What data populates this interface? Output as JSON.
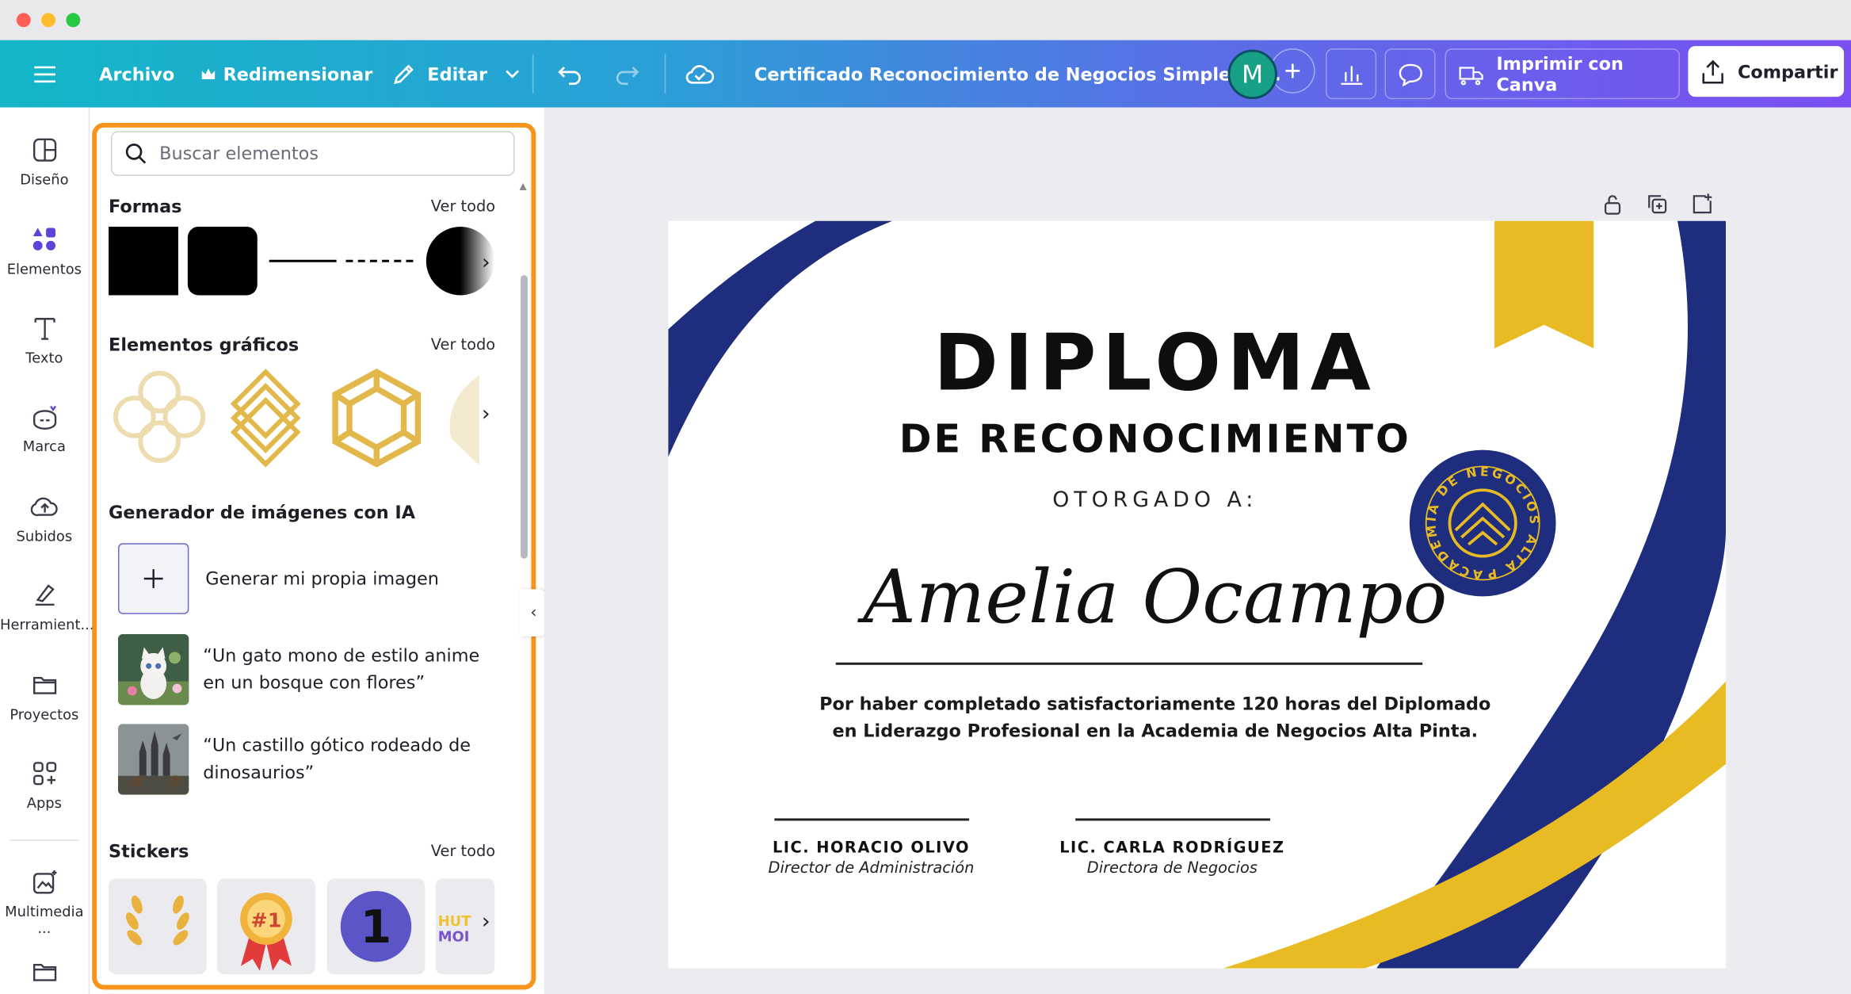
{
  "window": {
    "traffic_lights": [
      "#ff5f57",
      "#febc2e",
      "#28c840"
    ]
  },
  "toolbar": {
    "menu_label": "",
    "file": "Archivo",
    "resize": "Redimensionar",
    "edit": "Editar",
    "doc_title": "Certificado Reconocimiento de Negocios Simple Az...",
    "avatar_initial": "M",
    "print": "Imprimir con Canva",
    "share": "Compartir",
    "gradient_colors": [
      "#14b6c8",
      "#5a6ee6",
      "#7b4ff2"
    ]
  },
  "nav": {
    "items": [
      {
        "label": "Diseño",
        "icon": "layout-icon"
      },
      {
        "label": "Elementos",
        "icon": "elements-icon"
      },
      {
        "label": "Texto",
        "icon": "text-icon"
      },
      {
        "label": "Marca",
        "icon": "brand-icon"
      },
      {
        "label": "Subidos",
        "icon": "upload-cloud-icon"
      },
      {
        "label": "Herramient...",
        "icon": "tools-icon"
      },
      {
        "label": "Proyectos",
        "icon": "folder-icon"
      },
      {
        "label": "Apps",
        "icon": "apps-icon"
      },
      {
        "label": "Multimedia ...",
        "icon": "media-icon"
      }
    ],
    "active_index": 1
  },
  "panel": {
    "search_placeholder": "Buscar elementos",
    "shapes_title": "Formas",
    "graphics_title": "Elementos gráficos",
    "ai_title": "Generador de imágenes con IA",
    "stickers_title": "Stickers",
    "see_all": "Ver todo",
    "ai_generate": "Generar mi propia imagen",
    "ai_prompts": [
      [
        "“Un gato mono de estilo anime",
        "en un bosque con flores”"
      ],
      [
        "“Un castillo gótico rodeado de",
        "dinosaurios”"
      ]
    ],
    "sticker_number": "1",
    "sticker_badge": "#1",
    "sticker_text": [
      "HUT",
      "MOI"
    ],
    "highlight_color": "#f7941d"
  },
  "certificate": {
    "title": "DIPLOMA",
    "subtitle": "DE RECONOCIMIENTO",
    "awarded_to": "OTORGADO A:",
    "recipient": "Amelia Ocampo",
    "body_line1": "Por haber completado satisfactoriamente 120 horas del Diplomado",
    "body_line2": "en Liderazgo Profesional en la Academia de Negocios Alta Pinta.",
    "seal_text": "ACADEMIA DE NEGOCIOS ALTA PINTA",
    "signers": [
      {
        "name": "LIC. HORACIO OLIVO",
        "role": "Director de Administración"
      },
      {
        "name": "LIC. CARLA RODRÍGUEZ",
        "role": "Directora de Negocios"
      }
    ],
    "colors": {
      "navy": "#1e2d7d",
      "gold": "#e8bb24"
    }
  }
}
